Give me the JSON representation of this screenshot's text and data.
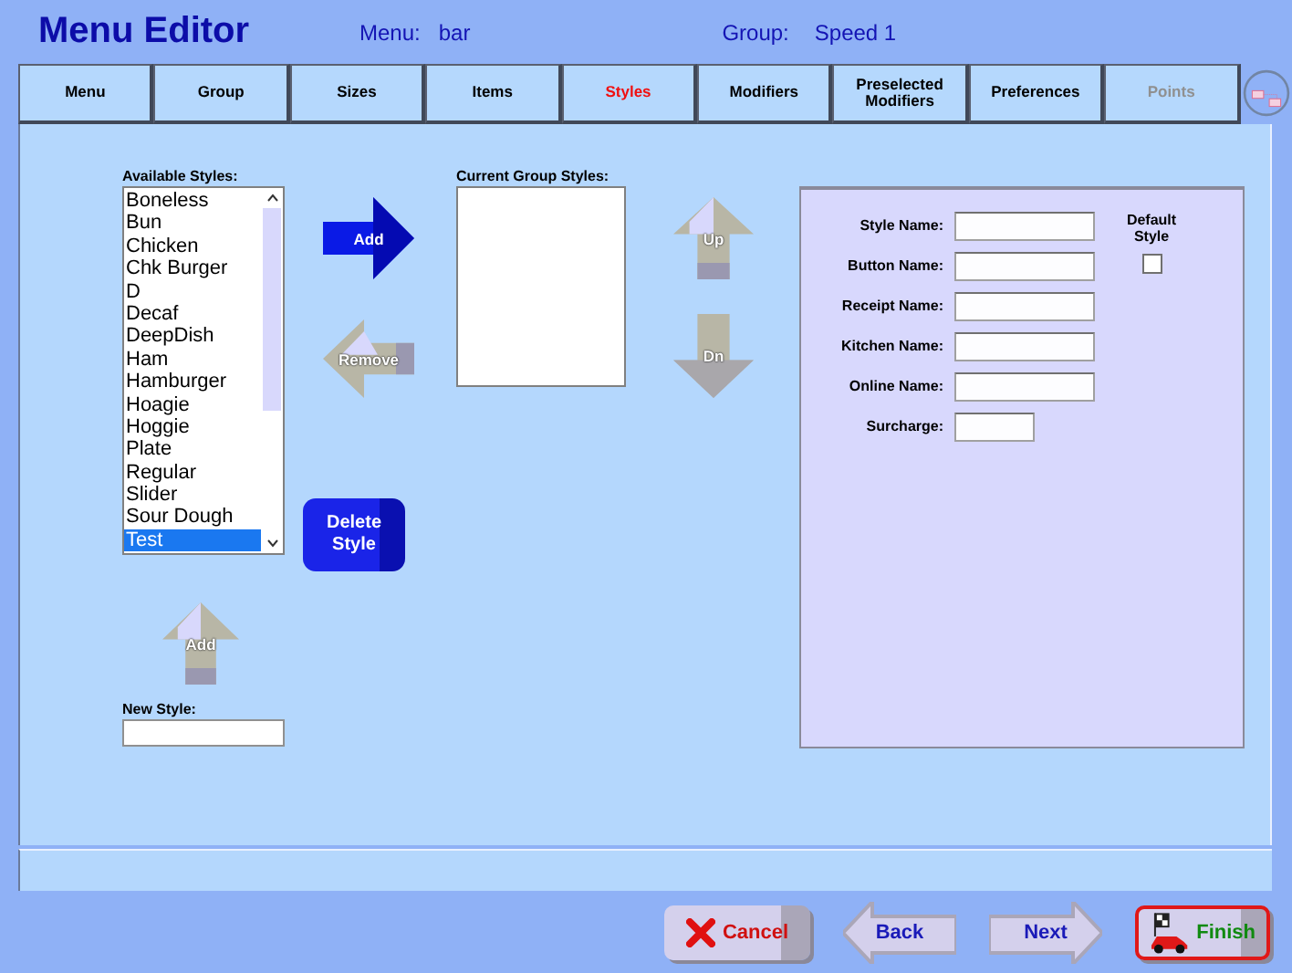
{
  "window": {
    "title": "Menu Editor"
  },
  "header": {
    "menu_label": "Menu:",
    "menu_value": "bar",
    "group_label": "Group:",
    "group_value": "Speed 1"
  },
  "tabs": [
    {
      "label": "Menu",
      "selected": false,
      "disabled": false
    },
    {
      "label": "Group",
      "selected": false,
      "disabled": false
    },
    {
      "label": "Sizes",
      "selected": false,
      "disabled": false
    },
    {
      "label": "Items",
      "selected": false,
      "disabled": false
    },
    {
      "label": "Styles",
      "selected": true,
      "disabled": false
    },
    {
      "label": "Modifiers",
      "selected": false,
      "disabled": false
    },
    {
      "label": "Preselected Modifiers",
      "selected": false,
      "disabled": false
    },
    {
      "label": "Preferences",
      "selected": false,
      "disabled": false
    },
    {
      "label": "Points",
      "selected": false,
      "disabled": true
    }
  ],
  "available_styles": {
    "label": "Available Styles:",
    "items": [
      {
        "label": "Boneless",
        "selected": false
      },
      {
        "label": "Bun",
        "selected": false
      },
      {
        "label": "Chicken",
        "selected": false
      },
      {
        "label": "Chk Burger",
        "selected": false
      },
      {
        "label": "D",
        "selected": false
      },
      {
        "label": "Decaf",
        "selected": false
      },
      {
        "label": "DeepDish",
        "selected": false
      },
      {
        "label": "Ham",
        "selected": false
      },
      {
        "label": "Hamburger",
        "selected": false
      },
      {
        "label": "Hoagie",
        "selected": false
      },
      {
        "label": "Hoggie",
        "selected": false
      },
      {
        "label": "Plate",
        "selected": false
      },
      {
        "label": "Regular",
        "selected": false
      },
      {
        "label": "Slider",
        "selected": false
      },
      {
        "label": "Sour Dough",
        "selected": false
      },
      {
        "label": "Test",
        "selected": true
      }
    ]
  },
  "add_button": {
    "label": "Add",
    "disabled": false
  },
  "remove_button": {
    "label": "Remove",
    "disabled": true
  },
  "delete_button": {
    "label": "Delete Style"
  },
  "current_group_styles": {
    "label": "Current Group Styles:"
  },
  "move_buttons": [
    {
      "label": "Up",
      "kind": "up",
      "disabled": true
    },
    {
      "label": "Dn",
      "kind": "down",
      "disabled": true
    }
  ],
  "form": {
    "fields": [
      {
        "label": "Style Name:",
        "kind": "long"
      },
      {
        "label": "Button Name:",
        "kind": "long"
      },
      {
        "label": "Receipt Name:",
        "kind": "long"
      },
      {
        "label": "Kitchen Name:",
        "kind": "long"
      },
      {
        "label": "Online Name:",
        "kind": "long"
      },
      {
        "label": "Surcharge:",
        "kind": "short"
      }
    ],
    "default_style": {
      "label": "Default Style",
      "checked": false
    }
  },
  "new_style": {
    "label": "New Style:",
    "add_button": {
      "label": "Add",
      "disabled": true
    }
  },
  "footer_buttons": [
    {
      "label": "Cancel",
      "kind": "cancel",
      "highlighted": false
    },
    {
      "label": "Back",
      "kind": "back",
      "highlighted": false
    },
    {
      "label": "Next",
      "kind": "next",
      "highlighted": false
    },
    {
      "label": "Finish",
      "kind": "finish",
      "highlighted": true
    }
  ]
}
